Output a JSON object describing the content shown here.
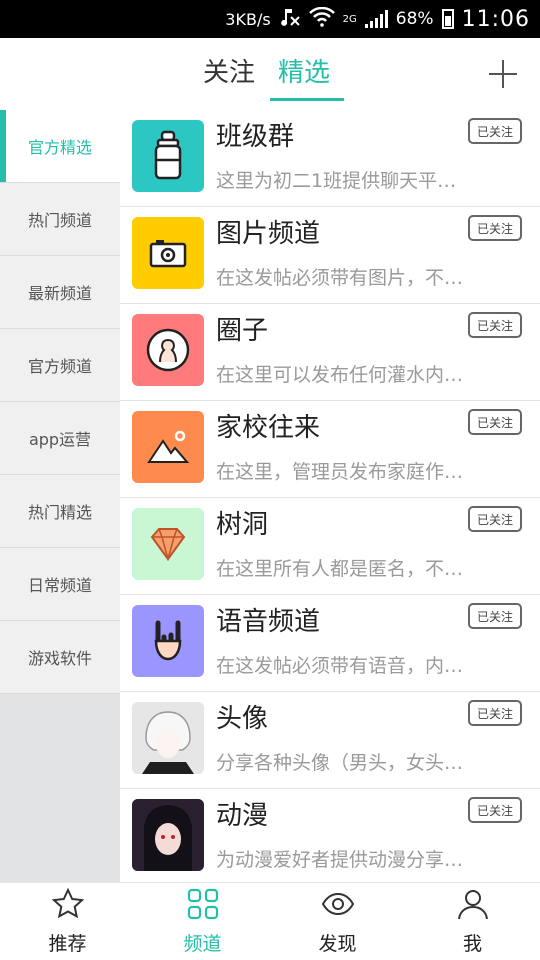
{
  "statusbar": {
    "net_speed": "3KB/s",
    "network": "2G",
    "battery": "68%",
    "time": "11:06"
  },
  "header": {
    "tabs": [
      {
        "label": "关注"
      },
      {
        "label": "精选"
      }
    ],
    "add_icon": "plus-icon"
  },
  "sidebar": {
    "items": [
      {
        "label": "官方精选"
      },
      {
        "label": "热门频道"
      },
      {
        "label": "最新频道"
      },
      {
        "label": "官方频道"
      },
      {
        "label": "app运营"
      },
      {
        "label": "热门精选"
      },
      {
        "label": "日常频道"
      },
      {
        "label": "游戏软件"
      }
    ]
  },
  "channels": [
    {
      "title": "班级群",
      "desc": "这里为初二1班提供聊天平…",
      "button": "已关注",
      "icon": "baby-bottle-icon",
      "color": "#2cc7c2"
    },
    {
      "title": "图片频道",
      "desc": "在这发帖必须带有图片，不…",
      "button": "已关注",
      "icon": "camera-icon",
      "color": "#ffcc00"
    },
    {
      "title": "圈子",
      "desc": "在这里可以发布任何灌水内…",
      "button": "已关注",
      "icon": "person-icon",
      "color": "#ff7b7b"
    },
    {
      "title": "家校往来",
      "desc": "在这里，管理员发布家庭作…",
      "button": "已关注",
      "icon": "mountain-icon",
      "color": "#ff8a4d"
    },
    {
      "title": "树洞",
      "desc": "在这里所有人都是匿名，不…",
      "button": "已关注",
      "icon": "diamond-icon",
      "color": "#c9f7d3"
    },
    {
      "title": "语音频道",
      "desc": "在这发帖必须带有语音，内…",
      "button": "已关注",
      "icon": "rock-hand-icon",
      "color": "#9b95ff"
    },
    {
      "title": "头像",
      "desc": "分享各种头像（男头，女头…",
      "button": "已关注",
      "icon": "avatar-image",
      "color": "#d9d9d9"
    },
    {
      "title": "动漫",
      "desc": "为动漫爱好者提供动漫分享…",
      "button": "已关注",
      "icon": "anime-image",
      "color": "#2a2030"
    }
  ],
  "bottom_nav": [
    {
      "label": "推荐",
      "icon": "star-icon"
    },
    {
      "label": "频道",
      "icon": "grid-icon"
    },
    {
      "label": "发现",
      "icon": "eye-icon"
    },
    {
      "label": "我",
      "icon": "user-icon"
    }
  ],
  "colors": {
    "accent": "#24bfa8"
  }
}
